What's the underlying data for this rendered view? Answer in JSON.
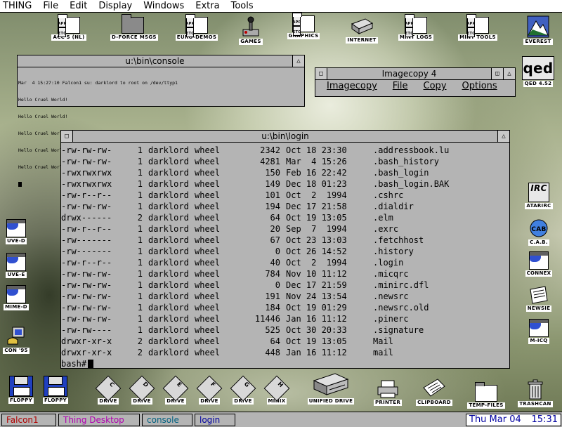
{
  "menubar": {
    "items": [
      "THING",
      "File",
      "Edit",
      "Display",
      "Windows",
      "Extra",
      "Tools"
    ]
  },
  "desktop_icons_top": [
    {
      "label": "ACC'S (NL)",
      "icon": "folder-app-etc-icon"
    },
    {
      "label": "D-FORCE MSGS",
      "icon": "folder-icon"
    },
    {
      "label": "EURO-DEMOS",
      "icon": "folder-app-etc-icon"
    },
    {
      "label": "GAMES",
      "icon": "joystick-icon"
    },
    {
      "label": "GRAPHICS",
      "icon": "folder-app-etc-icon"
    },
    {
      "label": "INTERNET",
      "icon": "modem-icon"
    },
    {
      "label": "MINT LOGS",
      "icon": "folder-app-etc-icon"
    },
    {
      "label": "MINT TOOLS",
      "icon": "folder-app-etc-icon"
    },
    {
      "label": "EVEREST",
      "icon": "mountain-icon"
    }
  ],
  "folder_doc_text": {
    "app": "APP",
    "etc": "ETC"
  },
  "qed": {
    "label": "QED 4.52",
    "logo": "qed"
  },
  "desktop_icons_right": [
    {
      "label": "ATARIRC",
      "icon": "irc-icon"
    },
    {
      "label": "C.A.B.",
      "icon": "cab-browser-icon"
    },
    {
      "label": "CONNEX",
      "icon": "connex-icon"
    },
    {
      "label": "NEWSIE",
      "icon": "newspaper-icon"
    },
    {
      "label": "M-ICQ",
      "icon": "icq-icon"
    }
  ],
  "desktop_icons_left": [
    {
      "label": "UVE-D",
      "icon": "app-icon"
    },
    {
      "label": "UVE-E",
      "icon": "app-icon"
    },
    {
      "label": "MIME-D",
      "icon": "app-icon"
    },
    {
      "label": "CON '95",
      "icon": "telephone-computer-icon"
    }
  ],
  "desktop_icons_bottom": [
    {
      "label": "FLOPPY",
      "letter": "A",
      "icon": "floppy-icon"
    },
    {
      "label": "FLOPPY",
      "letter": "B",
      "icon": "floppy-icon"
    },
    {
      "label": "DRIVE",
      "letter": "C",
      "icon": "drive-icon"
    },
    {
      "label": "DRIVE",
      "letter": "D",
      "icon": "drive-icon"
    },
    {
      "label": "DRIVE",
      "letter": "E",
      "icon": "drive-icon"
    },
    {
      "label": "DRIVE",
      "letter": "F",
      "icon": "drive-icon"
    },
    {
      "label": "DRIVE",
      "letter": "G",
      "icon": "drive-icon"
    },
    {
      "label": "MINIX",
      "letter": "H",
      "icon": "drive-icon"
    },
    {
      "label": "UNIFIED DRIVE",
      "icon": "unified-drive-icon"
    },
    {
      "label": "PRINTER",
      "icon": "printer-icon"
    },
    {
      "label": "CLIPBOARD",
      "icon": "clipboard-icon"
    },
    {
      "label": "TEMP-FILES",
      "icon": "folder-icon"
    },
    {
      "label": "TRASHCAN",
      "icon": "trashcan-icon"
    }
  ],
  "console_window": {
    "title": "u:\\bin\\console",
    "lines": [
      "Mar  4 15:27:10 Falcon1 su: darklord to root on /dev/ttyp1",
      "Hello Cruel World!",
      "Hello Cruel World!",
      "Hello Cruel World!",
      "Hello Cruel World!",
      "Hello Cruel World!"
    ]
  },
  "imagecopy_window": {
    "title": "Imagecopy 4",
    "menu": [
      "Imagecopy",
      "File",
      "Copy",
      "Options"
    ]
  },
  "login_window": {
    "title": "u:\\bin\\login",
    "rows": [
      {
        "perm": "-rw-rw-rw-",
        "links": "1",
        "owner": "darklord",
        "group": "wheel",
        "size": "2342",
        "date": "Oct 18 23:30",
        "name": ".addressbook.lu"
      },
      {
        "perm": "-rw-rw-rw-",
        "links": "1",
        "owner": "darklord",
        "group": "wheel",
        "size": "4281",
        "date": "Mar  4 15:26",
        "name": ".bash_history"
      },
      {
        "perm": "-rwxrwxrwx",
        "links": "1",
        "owner": "darklord",
        "group": "wheel",
        "size": "150",
        "date": "Feb 16 22:42",
        "name": ".bash_login"
      },
      {
        "perm": "-rwxrwxrwx",
        "links": "1",
        "owner": "darklord",
        "group": "wheel",
        "size": "149",
        "date": "Dec 18 01:23",
        "name": ".bash_login.BAK"
      },
      {
        "perm": "-rw-r--r--",
        "links": "1",
        "owner": "darklord",
        "group": "wheel",
        "size": "101",
        "date": "Oct  2  1994",
        "name": ".cshrc"
      },
      {
        "perm": "-rw-rw-rw-",
        "links": "1",
        "owner": "darklord",
        "group": "wheel",
        "size": "194",
        "date": "Dec 17 21:58",
        "name": ".dialdir"
      },
      {
        "perm": "drwx------",
        "links": "2",
        "owner": "darklord",
        "group": "wheel",
        "size": "64",
        "date": "Oct 19 13:05",
        "name": ".elm"
      },
      {
        "perm": "-rw-r--r--",
        "links": "1",
        "owner": "darklord",
        "group": "wheel",
        "size": "20",
        "date": "Sep  7  1994",
        "name": ".exrc"
      },
      {
        "perm": "-rw-------",
        "links": "1",
        "owner": "darklord",
        "group": "wheel",
        "size": "67",
        "date": "Oct 23 13:03",
        "name": ".fetchhost"
      },
      {
        "perm": "-rw-------",
        "links": "1",
        "owner": "darklord",
        "group": "wheel",
        "size": "0",
        "date": "Oct 26 14:52",
        "name": ".history"
      },
      {
        "perm": "-rw-r--r--",
        "links": "1",
        "owner": "darklord",
        "group": "wheel",
        "size": "40",
        "date": "Oct  2  1994",
        "name": ".login"
      },
      {
        "perm": "-rw-rw-rw-",
        "links": "1",
        "owner": "darklord",
        "group": "wheel",
        "size": "784",
        "date": "Nov 10 11:12",
        "name": ".micqrc"
      },
      {
        "perm": "-rw-rw-rw-",
        "links": "1",
        "owner": "darklord",
        "group": "wheel",
        "size": "0",
        "date": "Dec 17 21:59",
        "name": ".minirc.dfl"
      },
      {
        "perm": "-rw-rw-rw-",
        "links": "1",
        "owner": "darklord",
        "group": "wheel",
        "size": "191",
        "date": "Nov 24 13:54",
        "name": ".newsrc"
      },
      {
        "perm": "-rw-rw-rw-",
        "links": "1",
        "owner": "darklord",
        "group": "wheel",
        "size": "184",
        "date": "Oct 19 01:29",
        "name": ".newsrc.old"
      },
      {
        "perm": "-rw-rw-rw-",
        "links": "1",
        "owner": "darklord",
        "group": "wheel",
        "size": "11446",
        "date": "Jan 16 11:12",
        "name": ".pinerc"
      },
      {
        "perm": "-rw-rw----",
        "links": "1",
        "owner": "darklord",
        "group": "wheel",
        "size": "525",
        "date": "Oct 30 20:33",
        "name": ".signature"
      },
      {
        "perm": "drwxr-xr-x",
        "links": "2",
        "owner": "darklord",
        "group": "wheel",
        "size": "64",
        "date": "Oct 19 13:05",
        "name": "Mail"
      },
      {
        "perm": "drwxr-xr-x",
        "links": "2",
        "owner": "darklord",
        "group": "wheel",
        "size": "448",
        "date": "Jan 16 11:12",
        "name": "mail"
      }
    ],
    "prompt": "bash#"
  },
  "taskbar": {
    "tasks": [
      {
        "label": "Falcon1",
        "color": "#b00000"
      },
      {
        "label": "Thing Desktop",
        "color": "#b000b0"
      },
      {
        "label": "console",
        "color": "#006080"
      },
      {
        "label": "login",
        "color": "#0000a0"
      }
    ],
    "clock_date": "Thu Mar 04",
    "clock_time": "15:31"
  }
}
